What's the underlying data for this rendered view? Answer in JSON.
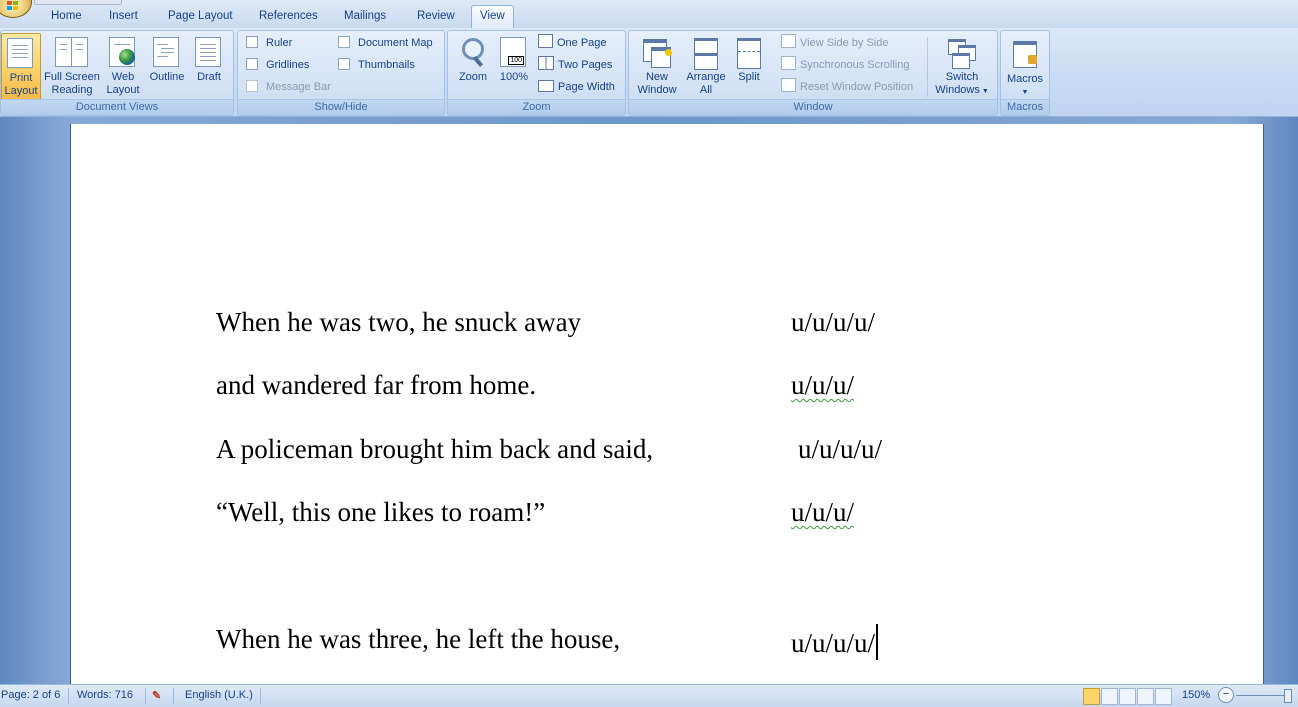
{
  "tabs": [
    "Home",
    "Insert",
    "Page Layout",
    "References",
    "Mailings",
    "Review",
    "View"
  ],
  "active_tab": "View",
  "ribbon": {
    "document_views": {
      "label": "Document Views",
      "print_layout": [
        "Print",
        "Layout"
      ],
      "full_screen_reading": [
        "Full Screen",
        "Reading"
      ],
      "web_layout": [
        "Web",
        "Layout"
      ],
      "outline": "Outline",
      "draft": "Draft"
    },
    "show_hide": {
      "label": "Show/Hide",
      "ruler": "Ruler",
      "gridlines": "Gridlines",
      "message_bar": "Message Bar",
      "document_map": "Document Map",
      "thumbnails": "Thumbnails"
    },
    "zoom": {
      "label": "Zoom",
      "zoom": "Zoom",
      "hundred": "100%",
      "one_page": "One Page",
      "two_pages": "Two Pages",
      "page_width": "Page Width"
    },
    "window": {
      "label": "Window",
      "new_window": [
        "New",
        "Window"
      ],
      "arrange_all": [
        "Arrange",
        "All"
      ],
      "split": "Split",
      "view_side_by_side": "View Side by Side",
      "synchronous_scrolling": "Synchronous Scrolling",
      "reset_window_position": "Reset Window Position",
      "switch_windows": [
        "Switch",
        "Windows"
      ]
    },
    "macros": {
      "label": "Macros",
      "macros": "Macros"
    }
  },
  "document": {
    "lines": [
      {
        "text": "When he was two, he snuck away",
        "meter": "u/u/u/u/"
      },
      {
        "text": "and wandered  far from home.",
        "meter": "u/u/u/"
      },
      {
        "text": "A policeman brought him back and said,",
        "meter": "u/u/u/u/"
      },
      {
        "text": "“Well, this one likes to roam!”",
        "meter": "u/u/u/"
      },
      {
        "text": "When he was three, he left the house,",
        "meter": "u/u/u/u/"
      }
    ]
  },
  "status": {
    "page": "Page: 2 of 6",
    "words": "Words: 716",
    "language": "English (U.K.)",
    "zoom": "150%"
  },
  "colors": {
    "ribbon_text": "#15428b",
    "active_button": "#fbd46a",
    "workspace": "#6f95c9"
  }
}
